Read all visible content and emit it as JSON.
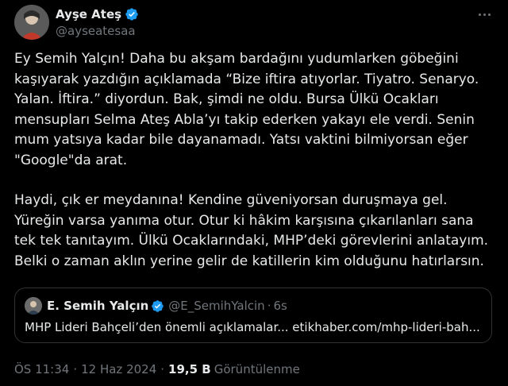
{
  "author": {
    "display_name": "Ayşe Ateş",
    "handle": "@ayseatesaa",
    "verified_icon": "verified-badge-icon",
    "verified_color": "#1d9bf0"
  },
  "tweet": {
    "paragraph_1": "Ey Semih Yalçın! Daha bu akşam bardağını yudumlarken göbeğini kaşıyarak yazdığın açıklamada “Bize iftira atıyorlar. Tiyatro. Senaryo. Yalan. İftira.” diyordun. Bak, şimdi ne oldu. Bursa Ülkü Ocakları mensupları Selma Ateş Abla’yı takip ederken yakayı ele verdi. Senin mum yatsıya kadar bile dayanamadı. Yatsı vaktini bilmiyorsan eğer \"Google\"da arat.",
    "paragraph_2": "Haydi, çık er meydanına! Kendine güveniyorsan duruşmaya gel. Yüreğin varsa yanıma otur. Otur ki hâkim karşısına çıkarılanları sana tek tek tanıtayım. Ülkü Ocaklarındaki, MHP’deki görevlerini anlatayım. Belki o zaman aklın yerine gelir de katillerin kim olduğunu hatırlarsın."
  },
  "quote": {
    "display_name": "E. Semih Yalçın",
    "handle": "@E_SemihYalcin",
    "separator": "·",
    "time": "6s",
    "text": "MHP Lideri Bahçeli’den önemli açıklamalar... etikhaber.com/mhp-lideri-bah..."
  },
  "meta": {
    "time": "ÖS 11:34",
    "separator": "·",
    "date": "12 Haz 2024",
    "views_count": "19,5 B",
    "views_label": "Görüntülenme"
  },
  "colors": {
    "background": "#000000",
    "text": "#e7e9ea",
    "muted": "#71767b",
    "border": "#2f3336",
    "accent": "#1d9bf0"
  }
}
